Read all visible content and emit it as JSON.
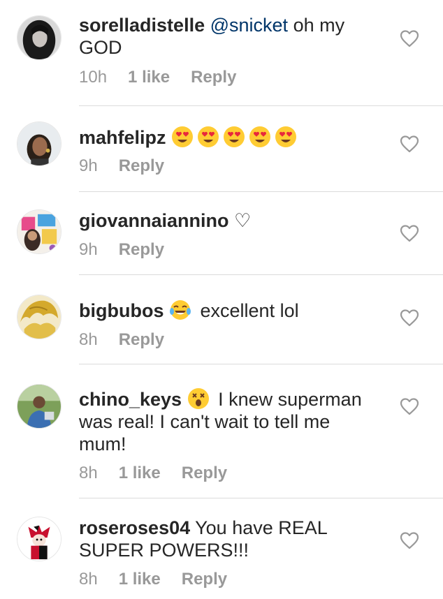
{
  "comments": [
    {
      "username": "sorelladistelle",
      "mention": "@snicket",
      "text": " oh my GOD",
      "time": "10h",
      "likes": "1 like",
      "reply": "Reply",
      "avatar": "dark-haired-woman"
    },
    {
      "username": "mahfelipz",
      "text": "",
      "emojis": [
        "heart-eyes",
        "heart-eyes",
        "heart-eyes",
        "heart-eyes",
        "heart-eyes"
      ],
      "time": "9h",
      "reply": "Reply",
      "avatar": "woman-with-earring"
    },
    {
      "username": "giovannaiannino",
      "text": " ♡",
      "time": "9h",
      "reply": "Reply",
      "avatar": "colorful-collage"
    },
    {
      "username": "bigbubos",
      "text": "excellent lol",
      "emojis": [
        "tears-of-joy"
      ],
      "time": "8h",
      "reply": "Reply",
      "avatar": "golden-anime-hair"
    },
    {
      "username": "chino_keys",
      "text": "I knew superman was real! I can't wait to tell me mum!",
      "emojis": [
        "astonished-face"
      ],
      "time": "8h",
      "likes": "1 like",
      "reply": "Reply",
      "avatar": "man-outdoors"
    },
    {
      "username": "roseroses04",
      "text": " You have REAL SUPER POWERS!!!",
      "time": "8h",
      "likes": "1 like",
      "reply": "Reply",
      "avatar": "harley-quinn-cartoon"
    }
  ],
  "colors": {
    "text": "#262626",
    "meta": "#999999",
    "mention": "#003569",
    "divider": "#dbdbdb"
  },
  "icons": {
    "like": "heart-outline-icon"
  }
}
